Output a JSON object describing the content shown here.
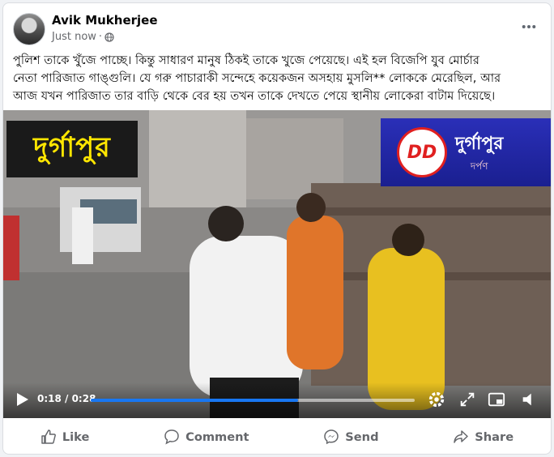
{
  "post": {
    "author": "Avik Mukherjee",
    "time": "Just now",
    "separator": "·",
    "privacy_icon": "globe-icon",
    "caption": "পুলিশ তাকে খুঁজে পাচ্ছে। কিন্তু সাধারণ মানুষ ঠিকই তাকে খুজে পেয়েছে। এই হল বিজেপি যুব মোর্চার\nনেতা পারিজাত গাঙ্গুলি। যে গরু পাচারাকী সন্দেহে কয়েকজন অসহায় মুসলি** লোককে মেরেছিল, আর\nআজ যখন পারিজাত তার বাড়ি থেকে বের হয় তখন তাকে দেখতে পেয়ে স্থানীয় লোকেরা বাটাম দিয়েছে।"
  },
  "video": {
    "badge_left": "দুর্গাপুর",
    "badge_right_logo": "DD",
    "badge_right_title": "দুর্গাপুর",
    "badge_right_subtitle": "দর্পণ",
    "time_display": "0:18 / 0:28",
    "progress": 0.64,
    "accent_color": "#1877f2"
  },
  "actions": {
    "like": "Like",
    "comment": "Comment",
    "send": "Send",
    "share": "Share"
  }
}
